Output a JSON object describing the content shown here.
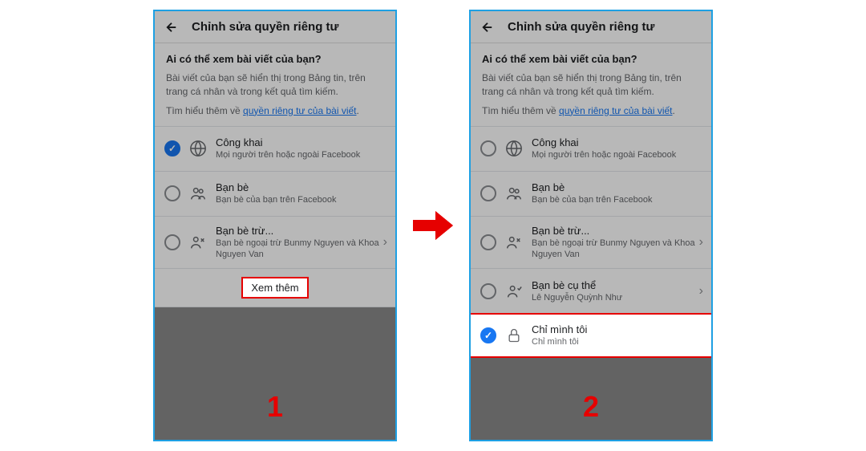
{
  "header": {
    "title": "Chỉnh sửa quyền riêng tư"
  },
  "question": {
    "title": "Ai có thể xem bài viết của bạn?",
    "desc": "Bài viết của bạn sẽ hiển thị trong Bảng tin, trên trang cá nhân và trong kết quả tìm kiếm.",
    "learn_prefix": "Tìm hiểu thêm về ",
    "learn_link": "quyền riêng tư của bài viết"
  },
  "options": {
    "public": {
      "title": "Công khai",
      "sub": "Mọi người trên hoặc ngoài Facebook"
    },
    "friends": {
      "title": "Bạn bè",
      "sub": "Bạn bè của bạn trên Facebook"
    },
    "except": {
      "title": "Bạn bè trừ...",
      "sub": "Bạn bè ngoại trừ Bunmy Nguyen và Khoa Nguyen Van"
    },
    "specific": {
      "title": "Bạn bè cụ thể",
      "sub": "Lê Nguyễn Quỳnh Như"
    },
    "only_me": {
      "title": "Chỉ mình tôi",
      "sub": "Chỉ mình tôi"
    }
  },
  "see_more": "Xem thêm",
  "steps": {
    "one": "1",
    "two": "2"
  }
}
